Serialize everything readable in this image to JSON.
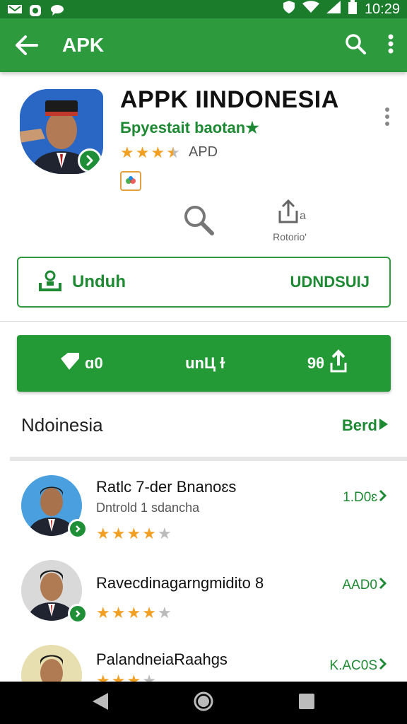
{
  "status_bar": {
    "time": "10:29",
    "icons": [
      "mail-icon",
      "instagram-icon",
      "chat-icon",
      "shield-icon",
      "wifi-icon",
      "signal-icon",
      "battery-icon"
    ]
  },
  "app_bar": {
    "title": "APK",
    "icons": [
      "back-arrow-icon",
      "search-icon",
      "more-vert-icon"
    ]
  },
  "app": {
    "title": "APPK IINDONESIA",
    "developer": "Бpyestait  baotan★",
    "rating": 3.5,
    "rating_label": "APD",
    "share_label": "Rotorio'"
  },
  "download": {
    "label": "Unduh",
    "right_text": "UDNDSUIJ"
  },
  "action_bar": {
    "item1": "ɑ0",
    "item2": "unЦ ɫ",
    "item3": "9θ"
  },
  "section": {
    "name": "Ndoinesia",
    "more": "Berd"
  },
  "list": [
    {
      "title": "Ratlc 7-der Bnanoɛs",
      "subtitle": "Dntrold 1 sdancha",
      "stars": 4,
      "meta": "1.D0ɛ"
    },
    {
      "title": "Ravecdinagarngmidito 8",
      "subtitle": "",
      "stars": 4,
      "meta": "AAD0"
    },
    {
      "title": "PalandneiaRaahgs",
      "subtitle": "",
      "stars": 3,
      "meta": "K.AC0S"
    }
  ],
  "colors": {
    "primary": "#2e9a3e",
    "status_bar": "#1b7d2c",
    "accent_text": "#1d8a33",
    "star": "#f2a024"
  }
}
